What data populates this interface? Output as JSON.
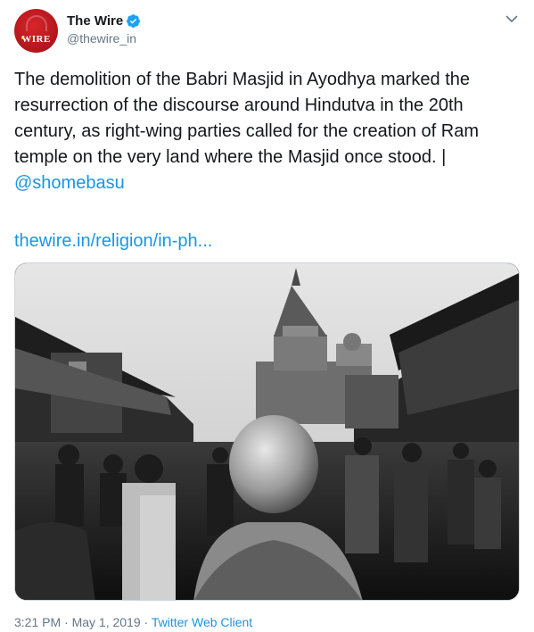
{
  "account": {
    "display_name": "The Wire",
    "handle": "@thewire_in",
    "avatar_text": "WIRE",
    "verified": true
  },
  "tweet": {
    "text": "The demolition of the Babri Masjid in Ayodhya marked the resurrection of the discourse around Hindutva in the 20th century, as right-wing parties called for the creation of Ram temple on the very land where the Masjid once stood. | ",
    "mention": "@shomebasu",
    "link": "thewire.in/religion/in-ph..."
  },
  "meta": {
    "time": "3:21 PM",
    "separator": " · ",
    "date": "May 1, 2019",
    "client": "Twitter Web Client"
  },
  "colors": {
    "accent": "#1b95e0",
    "brand_red": "#c8191f",
    "secondary_text": "#657786"
  }
}
